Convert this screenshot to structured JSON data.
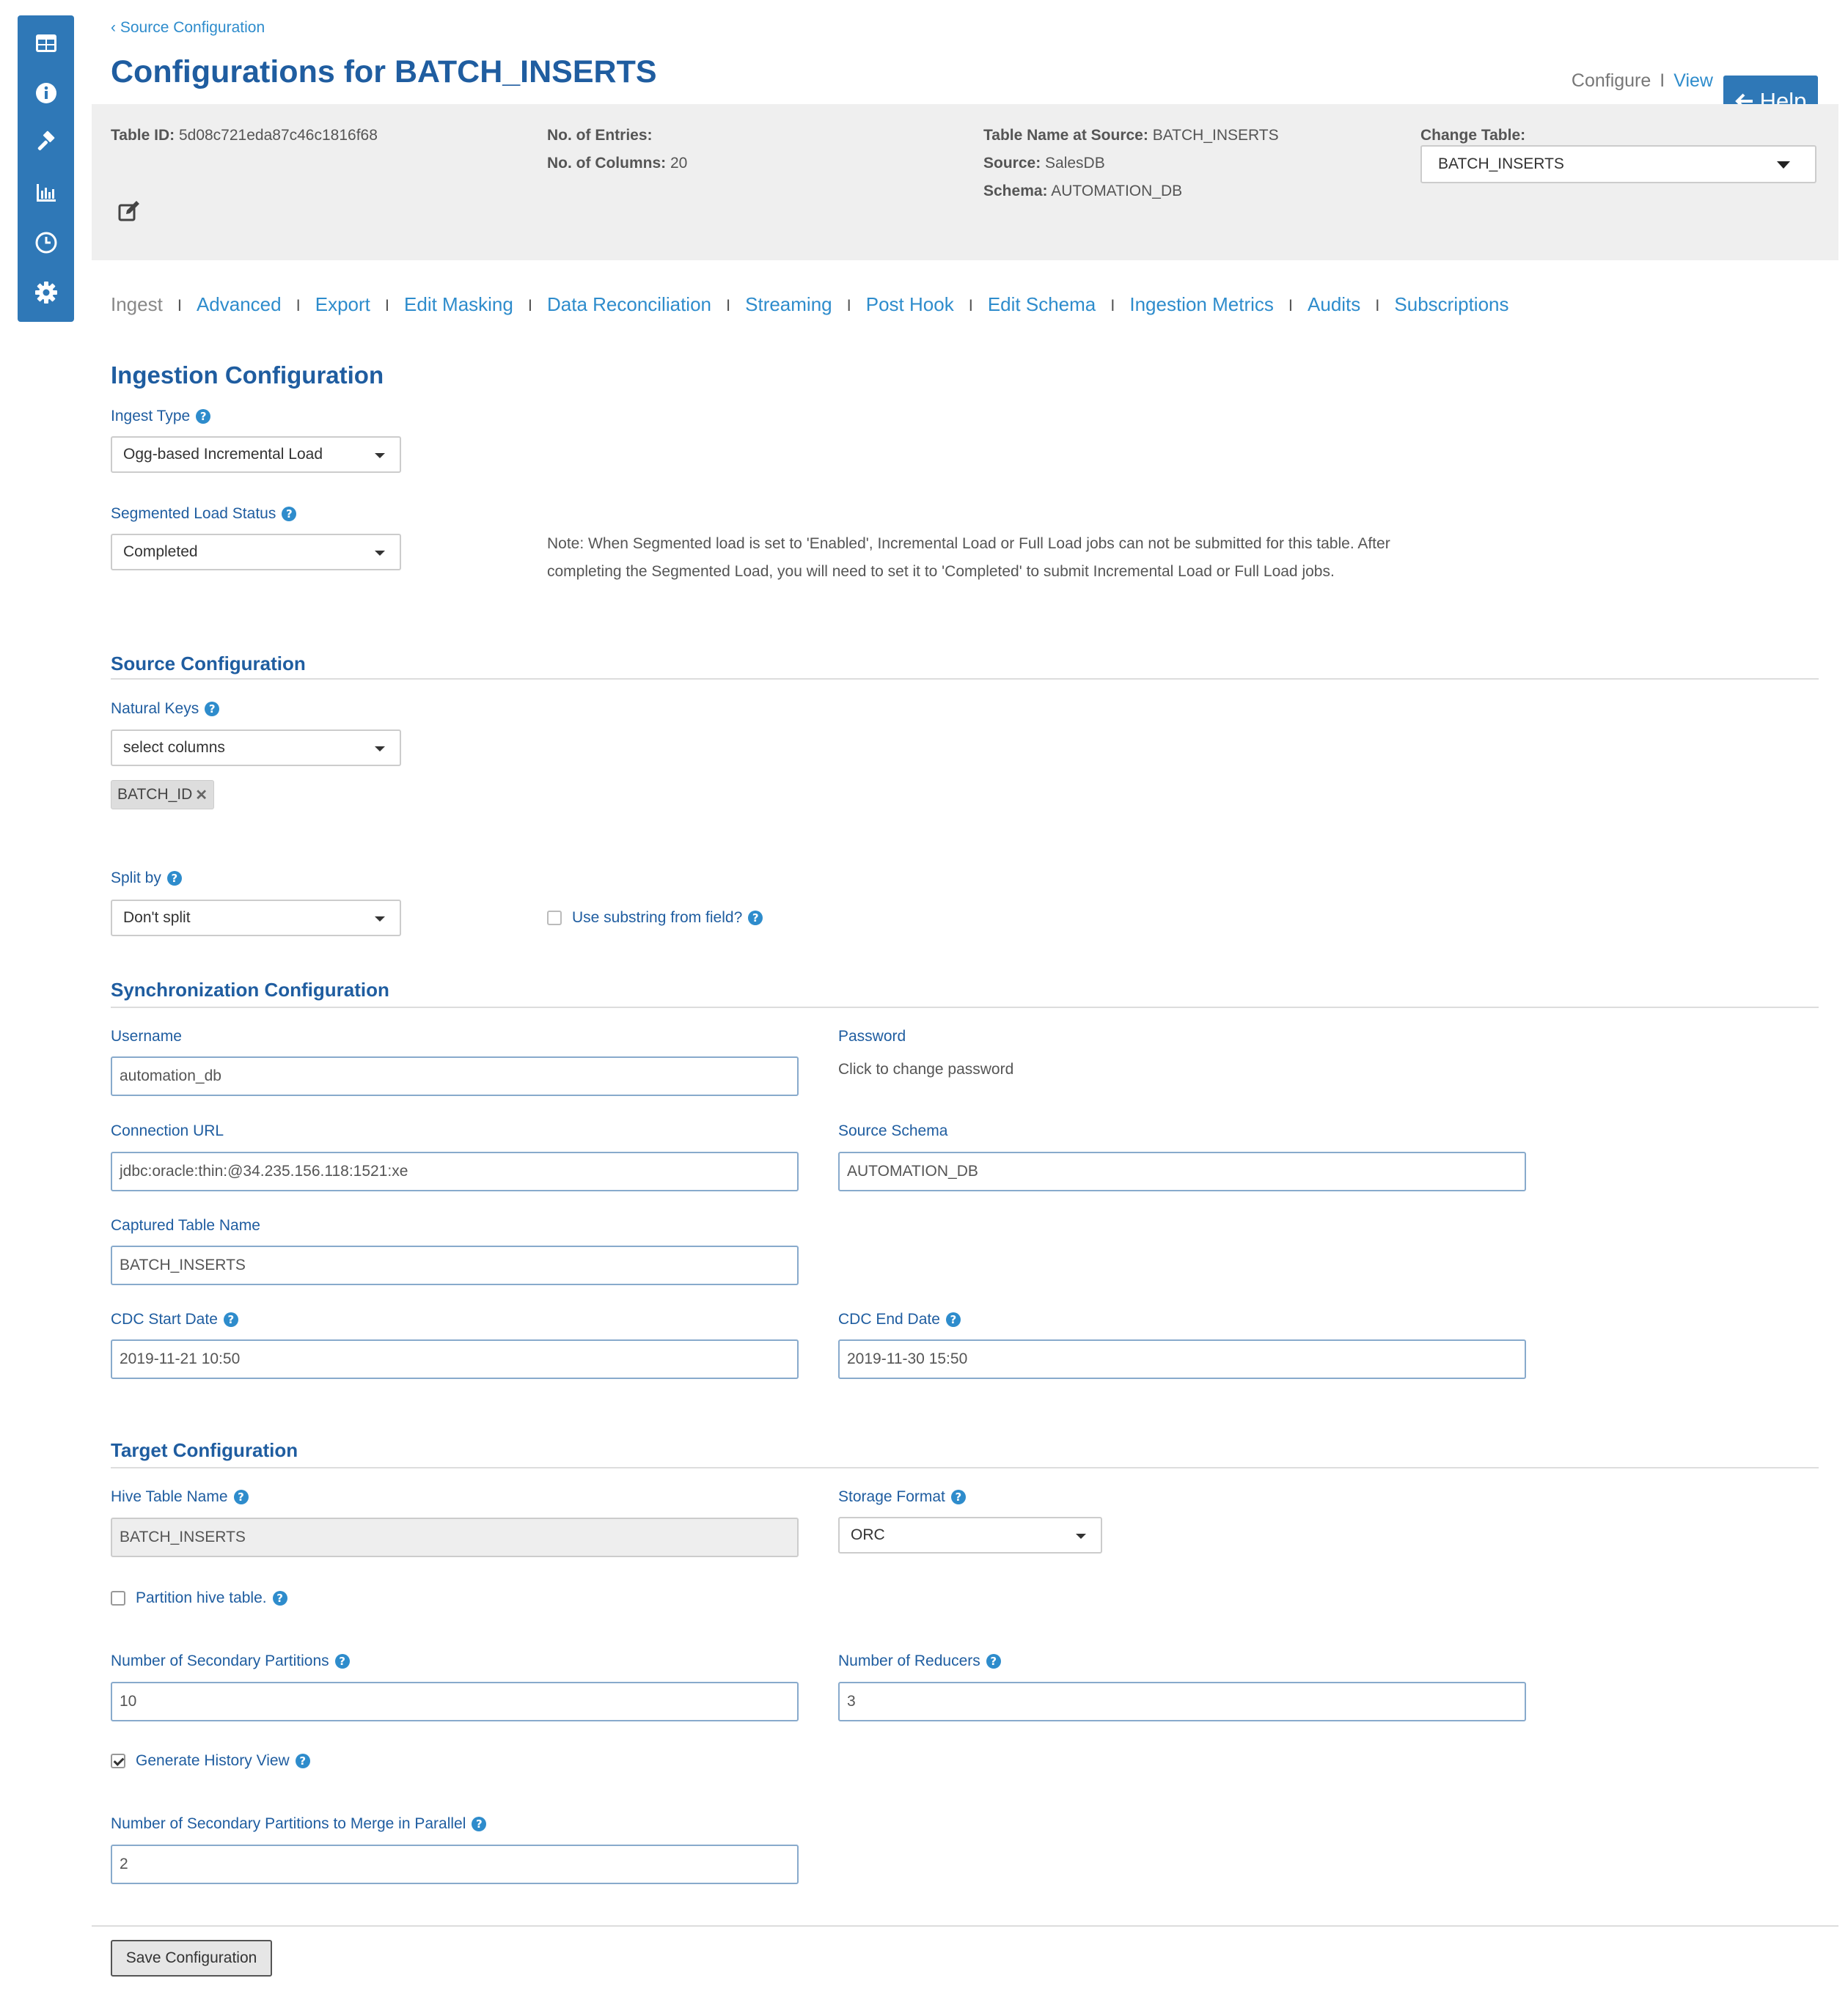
{
  "sidebar": {
    "icons": [
      "table-icon",
      "info-icon",
      "gavel-icon",
      "bar-chart-icon",
      "clock-icon",
      "gear-icon"
    ]
  },
  "header": {
    "back_link": "Source Configuration",
    "title": "Configurations for BATCH_INSERTS",
    "configure": "Configure",
    "view": "View",
    "help": "Help"
  },
  "info": {
    "table_id_label": "Table ID:",
    "table_id": "5d08c721eda87c46c1816f68",
    "entries_label": "No. of Entries:",
    "entries": "",
    "columns_label": "No. of Columns:",
    "columns": "20",
    "source_table_label": "Table Name at Source:",
    "source_table": "BATCH_INSERTS",
    "source_label": "Source:",
    "source": "SalesDB",
    "schema_label": "Schema:",
    "schema": "AUTOMATION_DB",
    "change_table_label": "Change Table:",
    "change_table": "BATCH_INSERTS"
  },
  "tabs": [
    "Ingest",
    "Advanced",
    "Export",
    "Edit Masking",
    "Data Reconciliation",
    "Streaming",
    "Post Hook",
    "Edit Schema",
    "Ingestion Metrics",
    "Audits",
    "Subscriptions"
  ],
  "ingestion": {
    "heading": "Ingestion Configuration",
    "ingest_type_label": "Ingest Type",
    "ingest_type": "Ogg-based Incremental Load",
    "segmented_label": "Segmented Load Status",
    "segmented": "Completed",
    "note": "Note: When Segmented load is set to 'Enabled', Incremental Load or Full Load jobs can not be submitted for this table. After completing the Segmented Load, you will need to set it to 'Completed' to submit Incremental Load or Full Load jobs."
  },
  "source": {
    "heading": "Source Configuration",
    "natural_keys_label": "Natural Keys",
    "natural_keys_placeholder": "select columns",
    "tag": "BATCH_ID",
    "split_label": "Split by",
    "split": "Don't split",
    "substring_label": "Use substring from field?"
  },
  "sync": {
    "heading": "Synchronization Configuration",
    "username_label": "Username",
    "username": "automation_db",
    "password_label": "Password",
    "password_hint": "Click to change password",
    "conn_label": "Connection URL",
    "conn": "jdbc:oracle:thin:@34.235.156.118:1521:xe",
    "source_schema_label": "Source Schema",
    "source_schema": "AUTOMATION_DB",
    "captured_label": "Captured Table Name",
    "captured": "BATCH_INSERTS",
    "cdc_start_label": "CDC Start Date",
    "cdc_start": "2019-11-21 10:50",
    "cdc_end_label": "CDC End Date",
    "cdc_end": "2019-11-30 15:50"
  },
  "target": {
    "heading": "Target Configuration",
    "hive_label": "Hive Table Name",
    "hive": "BATCH_INSERTS",
    "storage_label": "Storage Format",
    "storage": "ORC",
    "partition_label": "Partition hive table.",
    "sec_partitions_label": "Number of Secondary Partitions",
    "sec_partitions": "10",
    "reducers_label": "Number of Reducers",
    "reducers": "3",
    "history_label": "Generate History View",
    "merge_label": "Number of Secondary Partitions to Merge in Parallel",
    "merge": "2"
  },
  "save_label": "Save Configuration"
}
